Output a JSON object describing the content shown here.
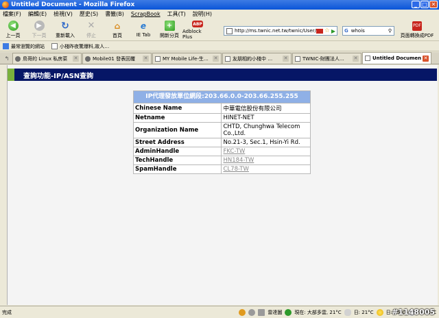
{
  "window": {
    "title": "Untitled Document - Mozilla Firefox"
  },
  "menu": [
    "檔案(F)",
    "編輯(E)",
    "檢視(V)",
    "歷史(S)",
    "書籤(B)",
    "ScrapBook",
    "工具(T)",
    "說明(H)"
  ],
  "toolbar": {
    "back": "上一頁",
    "forward": "下一頁",
    "reload": "重新載入",
    "stop": "停止",
    "home": "首頁",
    "ie_tab": "IE Tab",
    "new_tab": "開新分頁",
    "adblock": "Adblock Plus",
    "url": "http://ms.twnic.net.tw/twnic/User/Mem",
    "search": "whois",
    "pdf": "頁面轉換成PDF"
  },
  "bookmarks": [
    "最常瀏覽的網站",
    "小棧昨夜驚爆料,故人…"
  ],
  "tabs": [
    {
      "label": "鳥哥的 Linux 私房菜",
      "active": false
    },
    {
      "label": "Mobile01 發表回覆",
      "active": false
    },
    {
      "label": "MY Mobile Life-生…",
      "active": false
    },
    {
      "label": "友朋相約小棧中 …",
      "active": false
    },
    {
      "label": "TWNIC-財團法人…",
      "active": false
    },
    {
      "label": "Untitled Document",
      "active": true
    }
  ],
  "page": {
    "header": "查詢功能-IP/ASN查詢",
    "table_caption": "IP代理發放單位網段:203.66.0.0-203.66.255.255",
    "rows": [
      {
        "key": "Chinese Name",
        "value": "中華電信股份有限公司",
        "link": false
      },
      {
        "key": "Netname",
        "value": "HINET-NET",
        "link": false
      },
      {
        "key": "Organization Name",
        "value": "CHTD, Chunghwa Telecom Co.,Ltd.",
        "link": false
      },
      {
        "key": "Street Address",
        "value": "No.21-3, Sec.1, Hsin-Yi Rd.",
        "link": false
      },
      {
        "key": "AdminHandle",
        "value": "FKC-TW",
        "link": true
      },
      {
        "key": "TechHandle",
        "value": "HN184-TW",
        "link": true
      },
      {
        "key": "SpamHandle",
        "value": "CL78-TW",
        "link": true
      }
    ]
  },
  "status": {
    "text": "完成",
    "right": [
      "雷達圖",
      "現在: 大部多雲, 21°C",
      "日: 21°C",
      "日: 15°C",
      "— 22°C"
    ],
    "watermark": "#1148005"
  },
  "colors": {
    "header_bg": "#061666",
    "header_accent": "#7ab13c",
    "caption_bg": "#8fb0e6"
  }
}
